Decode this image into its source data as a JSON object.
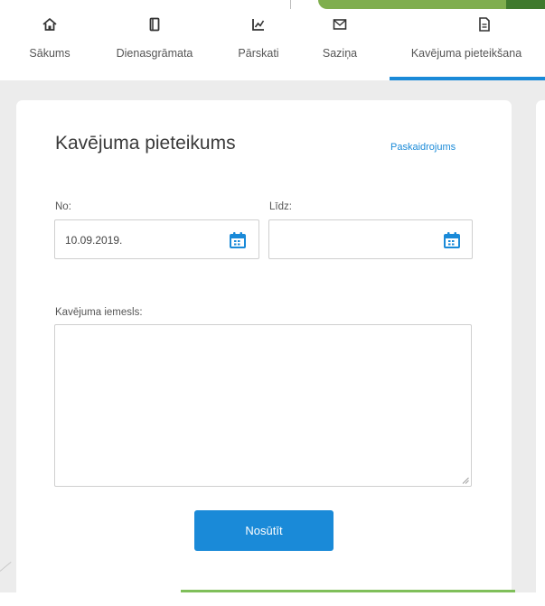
{
  "nav": {
    "items": [
      {
        "label": "Sākums",
        "icon": "home-icon"
      },
      {
        "label": "Dienasgrāmata",
        "icon": "diary-icon"
      },
      {
        "label": "Pārskati",
        "icon": "chart-icon"
      },
      {
        "label": "Saziņa",
        "icon": "envelope-icon"
      },
      {
        "label": "Kavējuma pieteikšana",
        "icon": "document-icon",
        "active": true
      }
    ]
  },
  "form": {
    "title": "Kavējuma pieteikums",
    "help_link": "Paskaidrojums",
    "from_label": "No:",
    "from_value": "10.09.2019.",
    "to_label": "Līdz:",
    "to_value": "",
    "reason_label": "Kavējuma iemesls:",
    "reason_value": "",
    "submit_label": "Nosūtīt"
  },
  "colors": {
    "accent": "#1a8ad8",
    "brand_green": "#7fae4e",
    "background": "#ececec"
  }
}
